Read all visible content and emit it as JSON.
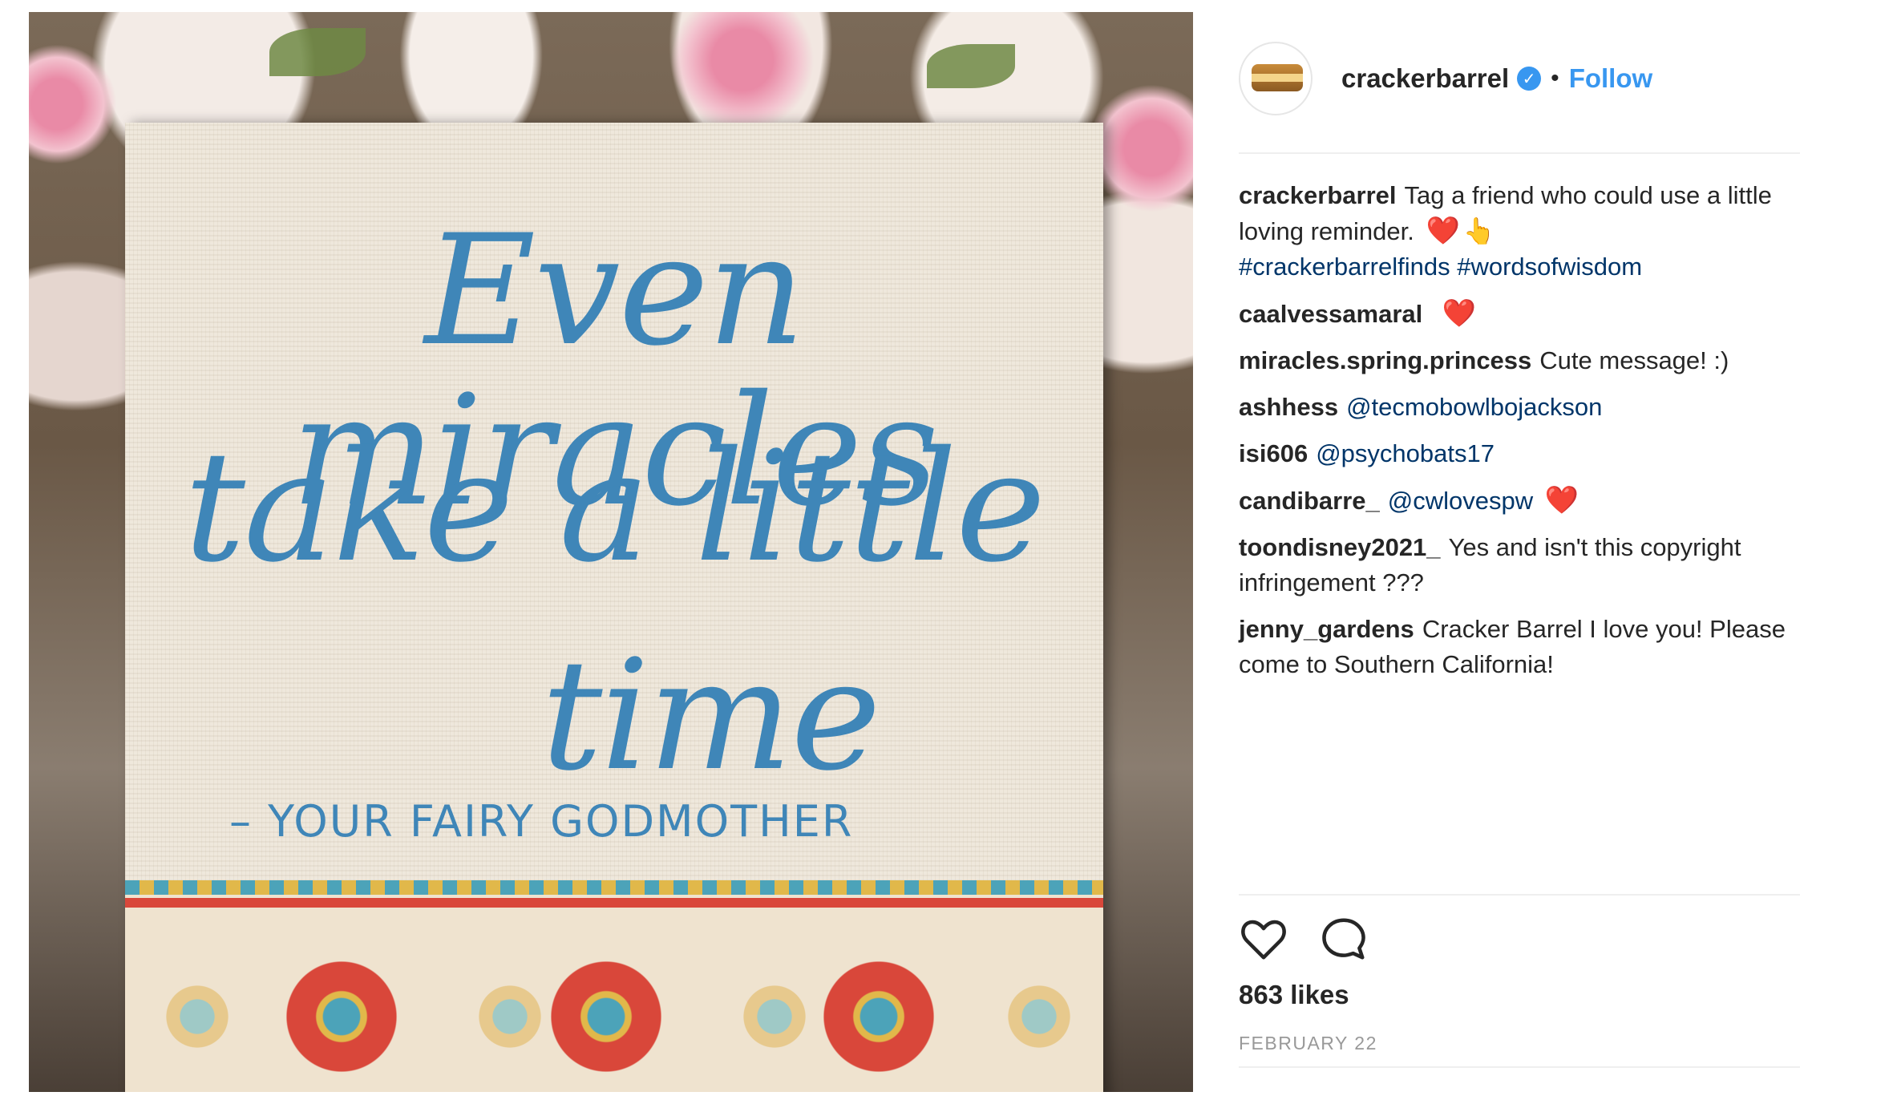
{
  "post": {
    "photo": {
      "quote_line1": "Even miracles",
      "quote_line2": "take a little",
      "quote_line3": "time",
      "attribution": "– YOUR FAIRY GODMOTHER"
    },
    "header": {
      "username": "crackerbarrel",
      "verified_icon": "verified-badge-icon",
      "separator": "•",
      "follow_label": "Follow"
    },
    "caption": {
      "username": "crackerbarrel",
      "text": "Tag a friend who could use a little loving reminder.",
      "emoji_1": "❤️",
      "emoji_2": "👆",
      "hashtag_1": "#crackerbarrelfinds",
      "hashtag_2": "#wordsofwisdom"
    },
    "comments": [
      {
        "user": "caalvessamaral",
        "text": "",
        "emoji": "❤️"
      },
      {
        "user": "miracles.spring.princess",
        "text": "Cute message! :)"
      },
      {
        "user": "ashhess",
        "mention": "@tecmobowlbojackson"
      },
      {
        "user": "isi606",
        "mention": "@psychobats17"
      },
      {
        "user": "candibarre_",
        "mention": "@cwlovespw",
        "emoji": "❤️"
      },
      {
        "user": "toondisney2021_",
        "text": "Yes and isn't this copyright infringement ???"
      },
      {
        "user": "jenny_gardens",
        "text": "Cracker Barrel I love you! Please come to Southern California!"
      }
    ],
    "likes": "863 likes",
    "date": "FEBRUARY 22",
    "colors": {
      "link_blue": "#3897f0",
      "text": "#262626",
      "tag": "#003569",
      "heart": "#e0403f",
      "muted": "#999999"
    },
    "icons": {
      "like": "heart-icon",
      "comment": "comment-bubble-icon"
    }
  }
}
